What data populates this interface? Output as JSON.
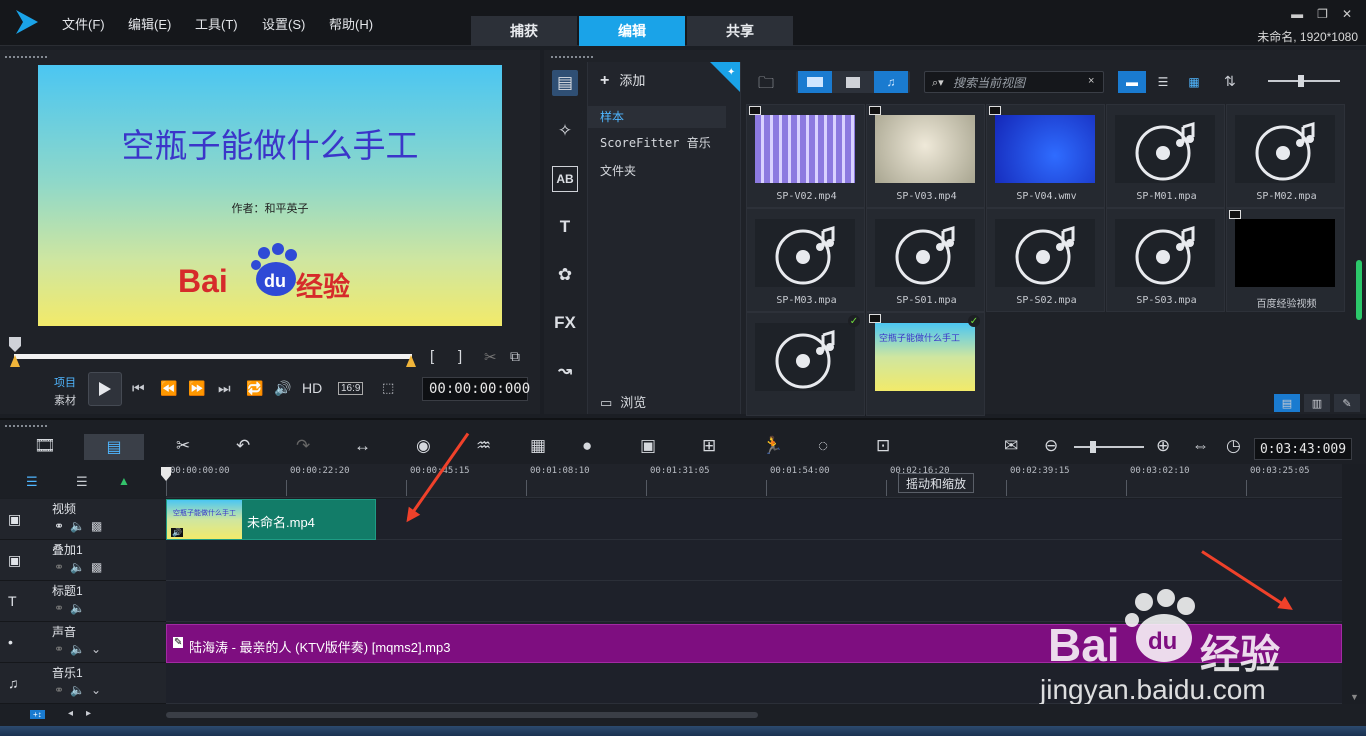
{
  "titlebar": {
    "menus": [
      "文件(F)",
      "编辑(E)",
      "工具(T)",
      "设置(S)",
      "帮助(H)"
    ],
    "tabs": [
      "捕获",
      "编辑",
      "共享"
    ],
    "active_tab": "编辑",
    "window_controls": [
      "▪",
      "▬",
      "❐",
      "✕"
    ],
    "project_info": "未命名, 1920*1080"
  },
  "preview": {
    "title": "空瓶子能做什么手工",
    "author": "作者：和平英子",
    "logo_text_bai": "Bai",
    "logo_text_du": "du",
    "logo_text_jingyan": "经验",
    "mode_project": "项目",
    "mode_clip": "素材",
    "hd_label": "HD",
    "aspect": "16:9",
    "timecode": "00:00:00:000",
    "mark_in": "[",
    "mark_out": "]"
  },
  "library": {
    "add_label": "添加",
    "tree": [
      "样本",
      "ScoreFitter 音乐",
      "文件夹"
    ],
    "selected_tree": "样本",
    "browse_label": "浏览",
    "search_placeholder": "搜索当前视图",
    "side_icons": [
      "media-icon",
      "transition-icon",
      "title-ab-icon",
      "text-icon",
      "graphics-icon",
      "fx-icon",
      "path-icon"
    ],
    "fx_label": "FX",
    "ab_label": "AB",
    "items": [
      {
        "label": "SP-V02.mp4",
        "kind": "video-tiles"
      },
      {
        "label": "SP-V03.mp4",
        "kind": "video-beige"
      },
      {
        "label": "SP-V04.wmv",
        "kind": "video-blue"
      },
      {
        "label": "SP-M01.mpa",
        "kind": "audio"
      },
      {
        "label": "SP-M02.mpa",
        "kind": "audio"
      },
      {
        "label": "SP-M03.mpa",
        "kind": "audio"
      },
      {
        "label": "SP-S01.mpa",
        "kind": "audio"
      },
      {
        "label": "SP-S02.mpa",
        "kind": "audio"
      },
      {
        "label": "SP-S03.mpa",
        "kind": "audio"
      },
      {
        "label": "百度经验视频",
        "kind": "video-black"
      },
      {
        "label": "",
        "kind": "audio-checked"
      },
      {
        "label": "",
        "kind": "video-project-checked"
      }
    ]
  },
  "timeline": {
    "duration": "0:03:43:009",
    "tooltip": "摇动和缩放",
    "ruler": [
      "00:00:00:00",
      "00:00:22:20",
      "00:00:45:15",
      "00:01:08:10",
      "00:01:31:05",
      "00:01:54:00",
      "00:02:16:20",
      "00:02:39:15",
      "00:03:02:10",
      "00:03:25:05"
    ],
    "tracks": [
      {
        "name": "视频",
        "icon": "video-track-icon"
      },
      {
        "name": "叠加1",
        "icon": "overlay-track-icon"
      },
      {
        "name": "标题1",
        "icon": "title-track-icon"
      },
      {
        "name": "声音",
        "icon": "voice-track-icon"
      },
      {
        "name": "音乐1",
        "icon": "music-track-icon"
      }
    ],
    "video_clip": "未命名.mp4",
    "audio_clip": "陆海涛 - 最亲的人 (KTV版伴奏) [mqms2].mp3"
  },
  "watermark": {
    "brand_bai": "Bai",
    "brand_du": "du",
    "brand_jingyan": "经验",
    "url": "jingyan.baidu.com"
  },
  "colors": {
    "accent": "#1aa3e8",
    "video_clip": "#127c68",
    "audio_clip": "#7e0e80",
    "annotation_arrow": "#f0412a"
  }
}
